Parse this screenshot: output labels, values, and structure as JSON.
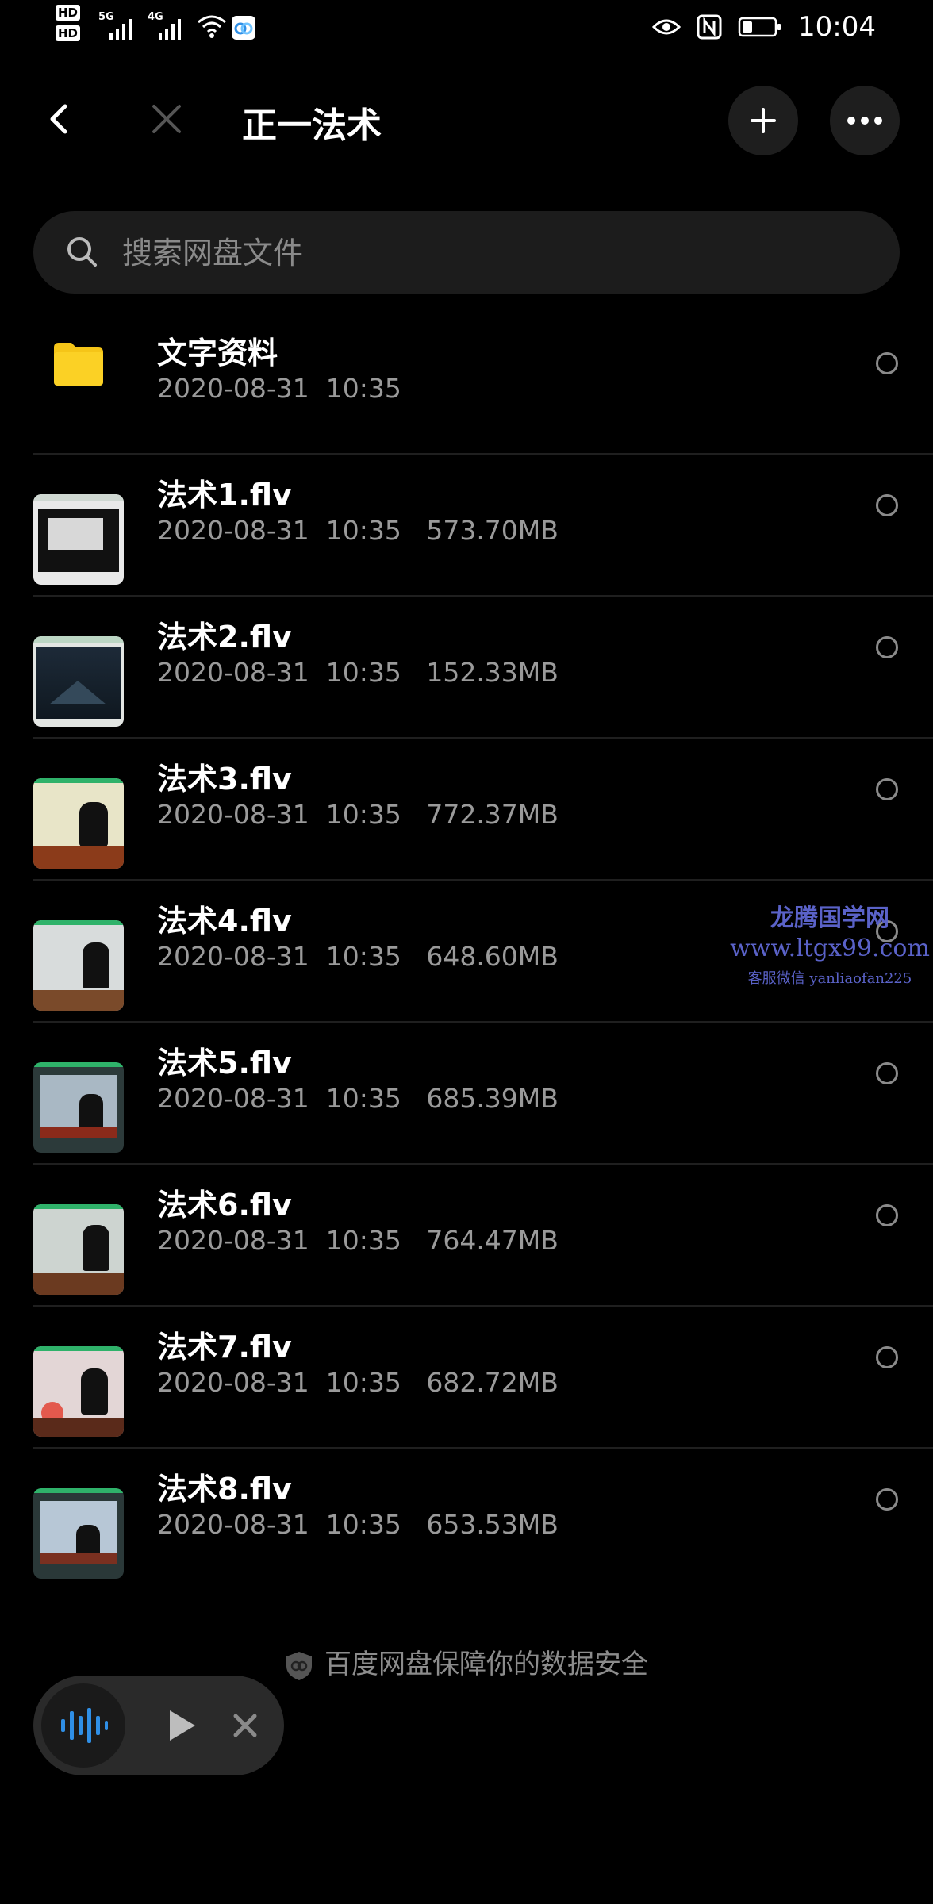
{
  "status_bar": {
    "hd1": "HD",
    "hd2": "HD",
    "sig1": "5G",
    "sig2": "4G",
    "time": "10:04"
  },
  "header": {
    "title": "正一法术"
  },
  "search": {
    "placeholder": "搜索网盘文件"
  },
  "files": [
    {
      "name": "文字资料",
      "meta": "2020-08-31  10:35",
      "type": "folder"
    },
    {
      "name": "法术1.flv",
      "meta": "2020-08-31  10:35   573.70MB",
      "type": "video"
    },
    {
      "name": "法术2.flv",
      "meta": "2020-08-31  10:35   152.33MB",
      "type": "video"
    },
    {
      "name": "法术3.flv",
      "meta": "2020-08-31  10:35   772.37MB",
      "type": "video"
    },
    {
      "name": "法术4.flv",
      "meta": "2020-08-31  10:35   648.60MB",
      "type": "video"
    },
    {
      "name": "法术5.flv",
      "meta": "2020-08-31  10:35   685.39MB",
      "type": "video"
    },
    {
      "name": "法术6.flv",
      "meta": "2020-08-31  10:35   764.47MB",
      "type": "video"
    },
    {
      "name": "法术7.flv",
      "meta": "2020-08-31  10:35   682.72MB",
      "type": "video"
    },
    {
      "name": "法术8.flv",
      "meta": "2020-08-31  10:35   653.53MB",
      "type": "video"
    }
  ],
  "footer": {
    "security_text": "百度网盘保障你的数据安全"
  },
  "watermark": {
    "line1": "龙腾国学网",
    "line2": "www.ltgx99.com",
    "line3": "客服微信 yanliaofan225"
  },
  "icons": {
    "back": "chevron-left-icon",
    "close": "close-icon",
    "add": "plus-icon",
    "more": "more-icon",
    "search": "search-icon",
    "folder": "folder-icon",
    "player_wave": "audio-wave-icon",
    "player_play": "play-icon",
    "player_close": "close-icon"
  },
  "colors": {
    "background": "#000000",
    "folder": "#f5c518",
    "wave": "#2f8fe6",
    "watermark": "#5a62c8"
  }
}
